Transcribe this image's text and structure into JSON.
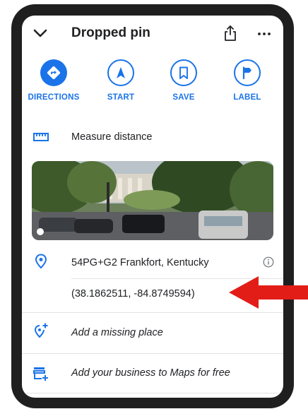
{
  "header": {
    "title": "Dropped pin",
    "back_icon": "chevron-down-icon",
    "share_icon": "share-icon",
    "more_icon": "more-horizontal-icon"
  },
  "actions": [
    {
      "label": "DIRECTIONS",
      "icon": "directions-icon"
    },
    {
      "label": "START",
      "icon": "navigation-arrow-icon"
    },
    {
      "label": "SAVE",
      "icon": "bookmark-icon"
    },
    {
      "label": "LABEL",
      "icon": "flag-icon"
    }
  ],
  "measure": {
    "label": "Measure distance",
    "icon": "ruler-icon"
  },
  "photo": {
    "kind": "street-view"
  },
  "location": {
    "plus_code": "54PG+G2 Frankfort, Kentucky",
    "coordinates": "(38.1862511, -84.8749594)",
    "icon": "location-pin-icon"
  },
  "missing_place": {
    "label": "Add a missing place",
    "icon": "add-place-icon"
  },
  "business": {
    "label": "Add your business to Maps for free",
    "icon": "add-business-icon"
  },
  "colors": {
    "accent": "#1a73e8",
    "frame": "#1f1f1f",
    "arrow": "#e21d18",
    "text": "#202124"
  }
}
